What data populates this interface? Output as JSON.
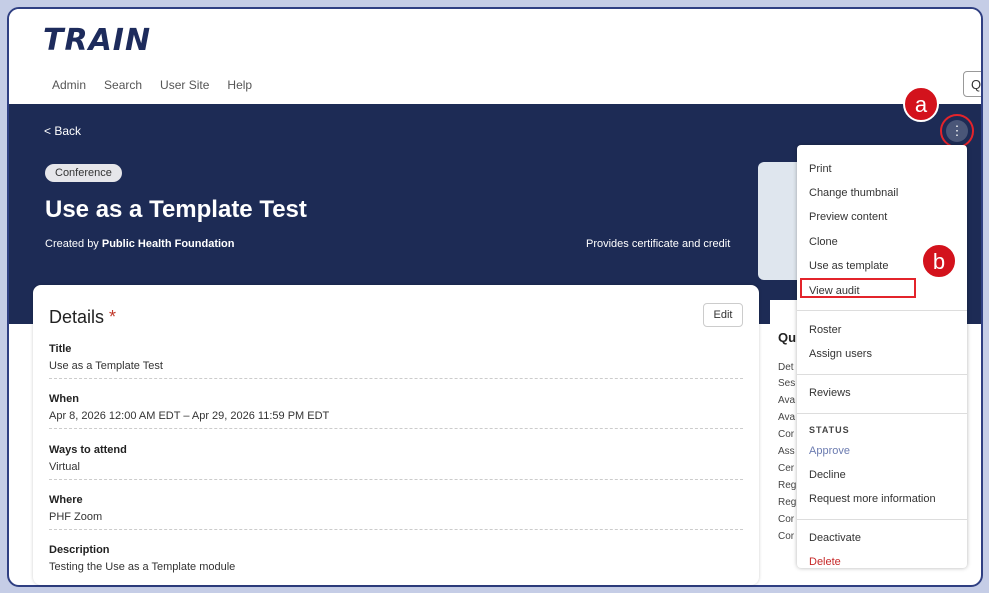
{
  "app": {
    "logo": "TRAIN"
  },
  "nav": [
    "Admin",
    "Search",
    "User Site",
    "Help"
  ],
  "search_icon": "search-icon",
  "back": "< Back",
  "badge": "Conference",
  "page_title": "Use as a Template Test",
  "created_by_prefix": "Created by ",
  "created_by_org": "Public Health Foundation",
  "provides": "Provides certificate and credit",
  "callouts": {
    "a": "a",
    "b": "b"
  },
  "details": {
    "heading": "Details",
    "required_mark": "*",
    "edit_label": "Edit",
    "fields": [
      {
        "label": "Title",
        "value": "Use as a Template Test"
      },
      {
        "label": "When",
        "value": "Apr 8, 2026 12:00 AM EDT  –  Apr 29, 2026 11:59 PM EDT"
      },
      {
        "label": "Ways to attend",
        "value": "Virtual"
      },
      {
        "label": "Where",
        "value": "PHF Zoom"
      },
      {
        "label": "Description",
        "value": "Testing the Use as a Template module"
      }
    ]
  },
  "sidebar": {
    "heading": "Qu",
    "items": [
      "Det",
      "Ses",
      "Ava",
      "Ava",
      "Cor",
      "Ass",
      "Cer",
      "Reg",
      "Reg",
      "Cor",
      "Cor"
    ]
  },
  "menu": {
    "group1": [
      "Print",
      "Change thumbnail",
      "Preview content",
      "Clone",
      "Use as template",
      "View audit"
    ],
    "group2": [
      "Roster",
      "Assign users"
    ],
    "group3": [
      "Reviews"
    ],
    "status_label": "STATUS",
    "status_items": [
      "Approve",
      "Decline",
      "Request more information"
    ],
    "group5": [
      "Deactivate",
      "Delete"
    ]
  }
}
